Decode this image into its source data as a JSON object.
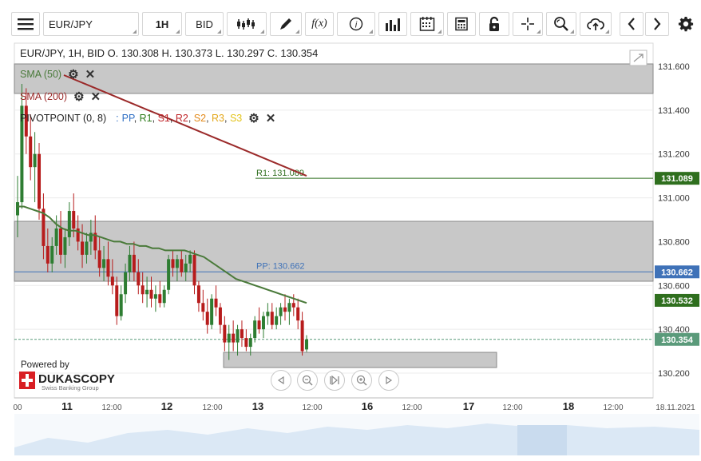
{
  "toolbar": {
    "menu_icon": "hamburger-icon",
    "instrument": "EUR/JPY",
    "period": "1H",
    "side": "BID",
    "icons": [
      "candlestick-icon",
      "draw-icon",
      "function-icon",
      "info-icon",
      "volume-bars-icon",
      "calendar-icon",
      "calculator-icon",
      "lock-icon",
      "crosshair-icon",
      "zoom-icon",
      "cloud-upload-icon",
      "arrow-left-icon",
      "arrow-right-icon",
      "gear-icon"
    ],
    "function_label": "f(x)"
  },
  "info": {
    "line": "EUR/JPY, 1H, BID    O. 130.308 H. 130.373 L. 130.297 C. 130.354"
  },
  "indicators": {
    "sma50": "SMA (50)",
    "sma200": "SMA (200)",
    "pivot_name": "PIVOTPOINT (0, 8)",
    "pivot_sep": ":",
    "pivot_parts": [
      {
        "text": "PP",
        "color": "#2f6fc4"
      },
      {
        "text": ", ",
        "color": "#333333"
      },
      {
        "text": "R1",
        "color": "#2b7a18"
      },
      {
        "text": ", ",
        "color": "#333333"
      },
      {
        "text": "S1",
        "color": "#c0262a"
      },
      {
        "text": ", ",
        "color": "#333333"
      },
      {
        "text": "R2",
        "color": "#c0262a"
      },
      {
        "text": ", ",
        "color": "#333333"
      },
      {
        "text": "S2",
        "color": "#e38a1b"
      },
      {
        "text": ", ",
        "color": "#333333"
      },
      {
        "text": "R3",
        "color": "#e3a71b"
      },
      {
        "text": ", ",
        "color": "#333333"
      },
      {
        "text": "S3",
        "color": "#e3c41b"
      }
    ],
    "settings_icon": "gear-icon",
    "close_icon": "close-icon"
  },
  "branding": {
    "powered": "Powered by",
    "name": "DUKASCOPY",
    "sub": "Swiss Banking Group"
  },
  "nav_icons": [
    "scroll-left-icon",
    "zoom-out-icon",
    "reset-icon",
    "zoom-in-icon",
    "scroll-right-icon"
  ],
  "colors": {
    "bull": "#2e7d32",
    "bear": "#b71c1c",
    "sma50": "#4a7a3a",
    "sma200": "#9b2a2a",
    "pp_line": "#3f72b8",
    "r1_line": "#2f6f1e",
    "last_price": "#5a9a7a",
    "band_fill": "#c8c8c8"
  },
  "chart_data": {
    "type": "candlestick",
    "instrument": "EUR/JPY",
    "timeframe": "1H",
    "y_ticks": [
      "131.600",
      "131.400",
      "131.200",
      "131.000",
      "130.800",
      "130.600",
      "130.400",
      "130.200"
    ],
    "x_ticks": [
      "00",
      "11",
      "12:00",
      "12",
      "12:00",
      "13",
      "12:00",
      "16",
      "12:00",
      "17",
      "12:00",
      "18",
      "12:00",
      "18.11.2021"
    ],
    "ylim": [
      130.1,
      131.7
    ],
    "last_ohlc": {
      "open": 130.308,
      "high": 130.373,
      "low": 130.297,
      "close": 130.354
    },
    "price_labels": [
      {
        "text": "131.089",
        "color": "#2f6f1e"
      },
      {
        "text": "130.662",
        "color": "#3f72b8"
      },
      {
        "text": "130.532",
        "color": "#2f6f1e"
      },
      {
        "text": "130.354",
        "color": "#5a9a7a"
      }
    ],
    "pivot_lines": [
      {
        "label": "R1: 131.089",
        "value": 131.089
      },
      {
        "label": "PP: 130.662",
        "value": 130.662
      }
    ],
    "candles": [
      {
        "o": 130.92,
        "h": 131.1,
        "l": 130.82,
        "c": 130.98
      },
      {
        "o": 130.98,
        "h": 131.52,
        "l": 130.95,
        "c": 131.42
      },
      {
        "o": 131.42,
        "h": 131.5,
        "l": 131.2,
        "c": 131.28
      },
      {
        "o": 131.28,
        "h": 131.38,
        "l": 131.08,
        "c": 131.14
      },
      {
        "o": 131.14,
        "h": 131.3,
        "l": 130.98,
        "c": 131.2
      },
      {
        "o": 131.2,
        "h": 131.25,
        "l": 130.9,
        "c": 130.95
      },
      {
        "o": 130.95,
        "h": 131.02,
        "l": 130.72,
        "c": 130.78
      },
      {
        "o": 130.78,
        "h": 130.86,
        "l": 130.66,
        "c": 130.7
      },
      {
        "o": 130.7,
        "h": 130.82,
        "l": 130.66,
        "c": 130.78
      },
      {
        "o": 130.78,
        "h": 130.92,
        "l": 130.74,
        "c": 130.86
      },
      {
        "o": 130.86,
        "h": 130.94,
        "l": 130.7,
        "c": 130.74
      },
      {
        "o": 130.74,
        "h": 130.86,
        "l": 130.68,
        "c": 130.82
      },
      {
        "o": 130.82,
        "h": 130.98,
        "l": 130.78,
        "c": 130.94
      },
      {
        "o": 130.94,
        "h": 131.02,
        "l": 130.82,
        "c": 130.86
      },
      {
        "o": 130.86,
        "h": 130.92,
        "l": 130.76,
        "c": 130.8
      },
      {
        "o": 130.8,
        "h": 130.88,
        "l": 130.68,
        "c": 130.74
      },
      {
        "o": 130.74,
        "h": 130.84,
        "l": 130.7,
        "c": 130.8
      },
      {
        "o": 130.8,
        "h": 130.9,
        "l": 130.74,
        "c": 130.84
      },
      {
        "o": 130.84,
        "h": 130.92,
        "l": 130.72,
        "c": 130.76
      },
      {
        "o": 130.76,
        "h": 130.82,
        "l": 130.64,
        "c": 130.68
      },
      {
        "o": 130.68,
        "h": 130.78,
        "l": 130.62,
        "c": 130.72
      },
      {
        "o": 130.72,
        "h": 130.8,
        "l": 130.6,
        "c": 130.64
      },
      {
        "o": 130.64,
        "h": 130.72,
        "l": 130.56,
        "c": 130.6
      },
      {
        "o": 130.6,
        "h": 130.64,
        "l": 130.42,
        "c": 130.46
      },
      {
        "o": 130.46,
        "h": 130.6,
        "l": 130.44,
        "c": 130.56
      },
      {
        "o": 130.56,
        "h": 130.7,
        "l": 130.52,
        "c": 130.66
      },
      {
        "o": 130.66,
        "h": 130.78,
        "l": 130.62,
        "c": 130.74
      },
      {
        "o": 130.74,
        "h": 130.8,
        "l": 130.62,
        "c": 130.66
      },
      {
        "o": 130.66,
        "h": 130.72,
        "l": 130.56,
        "c": 130.6
      },
      {
        "o": 130.6,
        "h": 130.66,
        "l": 130.52,
        "c": 130.56
      },
      {
        "o": 130.56,
        "h": 130.64,
        "l": 130.5,
        "c": 130.58
      },
      {
        "o": 130.58,
        "h": 130.64,
        "l": 130.5,
        "c": 130.54
      },
      {
        "o": 130.54,
        "h": 130.6,
        "l": 130.48,
        "c": 130.56
      },
      {
        "o": 130.56,
        "h": 130.62,
        "l": 130.5,
        "c": 130.52
      },
      {
        "o": 130.52,
        "h": 130.6,
        "l": 130.5,
        "c": 130.58
      },
      {
        "o": 130.58,
        "h": 130.74,
        "l": 130.56,
        "c": 130.72
      },
      {
        "o": 130.72,
        "h": 130.76,
        "l": 130.64,
        "c": 130.68
      },
      {
        "o": 130.68,
        "h": 130.74,
        "l": 130.62,
        "c": 130.72
      },
      {
        "o": 130.72,
        "h": 130.76,
        "l": 130.64,
        "c": 130.66
      },
      {
        "o": 130.66,
        "h": 130.74,
        "l": 130.62,
        "c": 130.7
      },
      {
        "o": 130.7,
        "h": 130.76,
        "l": 130.66,
        "c": 130.74
      },
      {
        "o": 130.74,
        "h": 130.76,
        "l": 130.56,
        "c": 130.6
      },
      {
        "o": 130.6,
        "h": 130.62,
        "l": 130.48,
        "c": 130.52
      },
      {
        "o": 130.52,
        "h": 130.58,
        "l": 130.44,
        "c": 130.48
      },
      {
        "o": 130.48,
        "h": 130.54,
        "l": 130.38,
        "c": 130.42
      },
      {
        "o": 130.42,
        "h": 130.56,
        "l": 130.4,
        "c": 130.54
      },
      {
        "o": 130.54,
        "h": 130.6,
        "l": 130.46,
        "c": 130.5
      },
      {
        "o": 130.5,
        "h": 130.52,
        "l": 130.38,
        "c": 130.42
      },
      {
        "o": 130.42,
        "h": 130.46,
        "l": 130.3,
        "c": 130.34
      },
      {
        "o": 130.34,
        "h": 130.42,
        "l": 130.26,
        "c": 130.38
      },
      {
        "o": 130.38,
        "h": 130.44,
        "l": 130.3,
        "c": 130.34
      },
      {
        "o": 130.34,
        "h": 130.42,
        "l": 130.28,
        "c": 130.4
      },
      {
        "o": 130.4,
        "h": 130.44,
        "l": 130.32,
        "c": 130.36
      },
      {
        "o": 130.36,
        "h": 130.4,
        "l": 130.3,
        "c": 130.32
      },
      {
        "o": 130.32,
        "h": 130.38,
        "l": 130.28,
        "c": 130.36
      },
      {
        "o": 130.36,
        "h": 130.46,
        "l": 130.34,
        "c": 130.44
      },
      {
        "o": 130.44,
        "h": 130.5,
        "l": 130.38,
        "c": 130.4
      },
      {
        "o": 130.4,
        "h": 130.48,
        "l": 130.36,
        "c": 130.46
      },
      {
        "o": 130.46,
        "h": 130.52,
        "l": 130.42,
        "c": 130.48
      },
      {
        "o": 130.48,
        "h": 130.52,
        "l": 130.4,
        "c": 130.42
      },
      {
        "o": 130.42,
        "h": 130.5,
        "l": 130.4,
        "c": 130.46
      },
      {
        "o": 130.46,
        "h": 130.52,
        "l": 130.42,
        "c": 130.5
      },
      {
        "o": 130.5,
        "h": 130.56,
        "l": 130.44,
        "c": 130.48
      },
      {
        "o": 130.48,
        "h": 130.54,
        "l": 130.42,
        "c": 130.52
      },
      {
        "o": 130.52,
        "h": 130.56,
        "l": 130.46,
        "c": 130.5
      },
      {
        "o": 130.5,
        "h": 130.54,
        "l": 130.4,
        "c": 130.44
      },
      {
        "o": 130.44,
        "h": 130.48,
        "l": 130.28,
        "c": 130.3
      },
      {
        "o": 130.308,
        "h": 130.373,
        "l": 130.297,
        "c": 130.354
      }
    ],
    "sma50": [
      130.96,
      130.96,
      130.95,
      130.94,
      130.93,
      130.91,
      130.88,
      130.86,
      130.85,
      130.85,
      130.84,
      130.83,
      130.83,
      130.82,
      130.81,
      130.8,
      130.8,
      130.79,
      130.79,
      130.78,
      130.78,
      130.77,
      130.77,
      130.76,
      130.76,
      130.76,
      130.76,
      130.75,
      130.74,
      130.73,
      130.71,
      130.69,
      130.67,
      130.65,
      130.63,
      130.62,
      130.61,
      130.6,
      130.59,
      130.58,
      130.57,
      130.56,
      130.55,
      130.54,
      130.53,
      130.52
    ],
    "sma200": [
      131.56,
      131.54,
      131.52,
      131.5,
      131.48,
      131.46,
      131.44,
      131.42,
      131.4,
      131.38,
      131.36,
      131.34,
      131.32,
      131.3,
      131.28,
      131.26,
      131.24,
      131.22,
      131.2,
      131.18,
      131.16,
      131.14,
      131.12,
      131.1
    ]
  }
}
